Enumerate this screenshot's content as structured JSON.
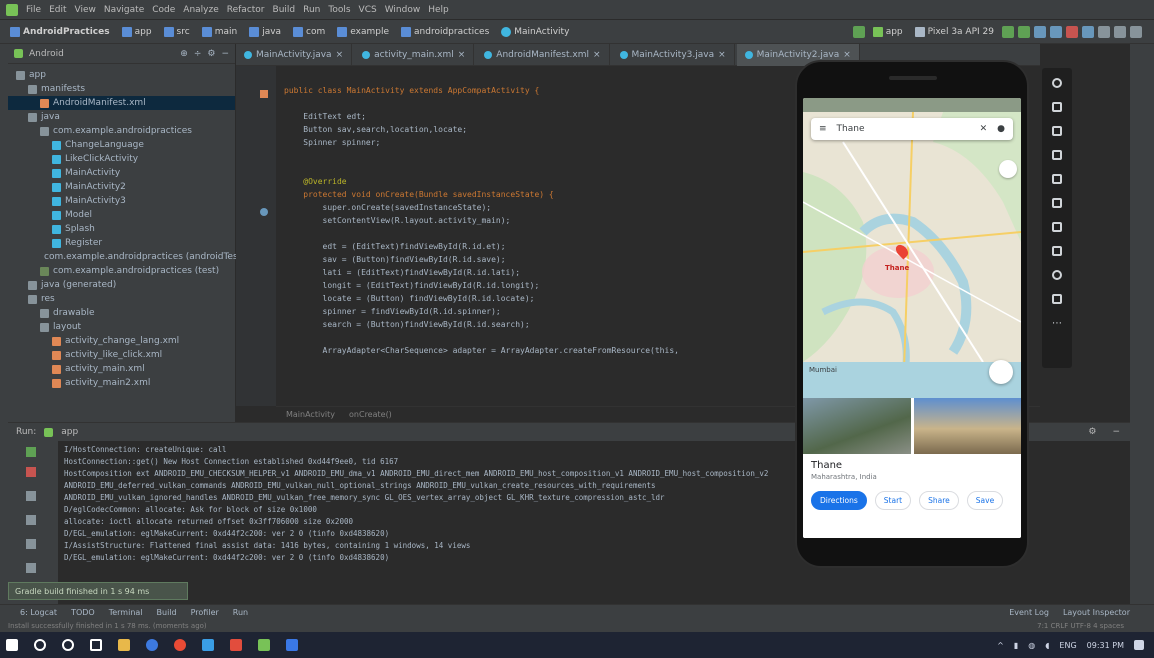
{
  "titlebar": {
    "menus": [
      "File",
      "Edit",
      "View",
      "Navigate",
      "Code",
      "Analyze",
      "Refactor",
      "Build",
      "Run",
      "Tools",
      "VCS",
      "Window",
      "Help"
    ]
  },
  "navbar": {
    "crumbs": [
      "AndroidPractices",
      "app",
      "src",
      "main",
      "java",
      "com",
      "example",
      "androidpractices",
      "MainActivity"
    ],
    "device": "app",
    "device_select": "Pixel 3a API 29"
  },
  "project": {
    "dropdown": "Android",
    "items": [
      {
        "label": "app",
        "level": 0,
        "color": "#87939a"
      },
      {
        "label": "manifests",
        "level": 1,
        "color": "#87939a"
      },
      {
        "label": "AndroidManifest.xml",
        "level": 2,
        "color": "#e08855",
        "selected": true
      },
      {
        "label": "java",
        "level": 1,
        "color": "#87939a"
      },
      {
        "label": "com.example.androidpractices",
        "level": 2,
        "color": "#87939a"
      },
      {
        "label": "ChangeLanguage",
        "level": 3,
        "color": "#40b6e0"
      },
      {
        "label": "LikeClickActivity",
        "level": 3,
        "color": "#40b6e0"
      },
      {
        "label": "MainActivity",
        "level": 3,
        "color": "#40b6e0"
      },
      {
        "label": "MainActivity2",
        "level": 3,
        "color": "#40b6e0"
      },
      {
        "label": "MainActivity3",
        "level": 3,
        "color": "#40b6e0"
      },
      {
        "label": "Model",
        "level": 3,
        "color": "#40b6e0"
      },
      {
        "label": "Splash",
        "level": 3,
        "color": "#40b6e0"
      },
      {
        "label": "Register",
        "level": 3,
        "color": "#40b6e0"
      },
      {
        "label": "com.example.androidpractices (androidTest)",
        "level": 2,
        "color": "#6a8759"
      },
      {
        "label": "com.example.androidpractices (test)",
        "level": 2,
        "color": "#6a8759"
      },
      {
        "label": "java (generated)",
        "level": 1,
        "color": "#87939a"
      },
      {
        "label": "res",
        "level": 1,
        "color": "#87939a"
      },
      {
        "label": "drawable",
        "level": 2,
        "color": "#87939a"
      },
      {
        "label": "layout",
        "level": 2,
        "color": "#87939a"
      },
      {
        "label": "activity_change_lang.xml",
        "level": 3,
        "color": "#e08855"
      },
      {
        "label": "activity_like_click.xml",
        "level": 3,
        "color": "#e08855"
      },
      {
        "label": "activity_main.xml",
        "level": 3,
        "color": "#e08855"
      },
      {
        "label": "activity_main2.xml",
        "level": 3,
        "color": "#e08855"
      }
    ]
  },
  "tabs": [
    {
      "label": "MainActivity.java",
      "active": false
    },
    {
      "label": "activity_main.xml",
      "active": false
    },
    {
      "label": "AndroidManifest.xml",
      "active": false
    },
    {
      "label": "MainActivity3.java",
      "active": false
    },
    {
      "label": "MainActivity2.java",
      "active": true
    }
  ],
  "editor": {
    "lines": [
      "public class MainActivity extends AppCompatActivity {",
      "",
      "    EditText edt;",
      "    Button sav,search,location,locate;",
      "    Spinner spinner;",
      "",
      "",
      "    @Override",
      "    protected void onCreate(Bundle savedInstanceState) {",
      "        super.onCreate(savedInstanceState);",
      "        setContentView(R.layout.activity_main);",
      "",
      "        edt = (EditText)findViewById(R.id.et);",
      "        sav = (Button)findViewById(R.id.save);",
      "        lati = (EditText)findViewById(R.id.lati);",
      "        longit = (EditText)findViewById(R.id.longit);",
      "        locate = (Button) findViewById(R.id.locate);",
      "        spinner = findViewById(R.id.spinner);",
      "        search = (Button)findViewById(R.id.search);",
      "",
      "        ArrayAdapter<CharSequence> adapter = ArrayAdapter.createFromResource(this,"
    ],
    "breadcrumb": [
      "MainActivity",
      "onCreate()"
    ]
  },
  "logcat": {
    "title": "Run:",
    "run_config": "app",
    "lines": [
      "I/HostConnection: createUnique: call",
      "    HostConnection::get() New Host Connection established 0xd44f9ee0, tid 6167",
      "    HostComposition ext ANDROID_EMU_CHECKSUM_HELPER_v1 ANDROID_EMU_dma_v1 ANDROID_EMU_direct_mem ANDROID_EMU_host_composition_v1 ANDROID_EMU_host_composition_v2",
      "    ANDROID_EMU_deferred_vulkan_commands ANDROID_EMU_vulkan_null_optional_strings ANDROID_EMU_vulkan_create_resources_with_requirements",
      "    ANDROID_EMU_vulkan_ignored_handles ANDROID_EMU_vulkan_free_memory_sync GL_OES_vertex_array_object GL_KHR_texture_compression_astc_ldr",
      "D/eglCodecCommon: allocate: Ask for block of size 0x1000",
      "    allocate: ioctl allocate returned offset 0x3ff706000 size 0x2000",
      "D/EGL_emulation: eglMakeCurrent: 0xd44f2c200: ver 2 0 (tinfo 0xd4838620)",
      "I/AssistStructure: Flattened final assist data: 1416 bytes, containing 1 windows, 14 views",
      "D/EGL_emulation: eglMakeCurrent: 0xd44f2c200: ver 2 0 (tinfo 0xd4838620)"
    ]
  },
  "gradle_balloon": "Gradle build finished in 1 s 94 ms",
  "bottom_tools": [
    "6: Logcat",
    "TODO",
    "Terminal",
    "Build",
    "Profiler",
    "Run"
  ],
  "bottom_right": [
    "Event Log",
    "Layout Inspector"
  ],
  "status": "Install successfully finished in 1 s 78 ms. (moments ago)",
  "status_right": "7:1  CRLF  UTF-8  4 spaces",
  "phone": {
    "search_text": "Thane",
    "place_name": "Thane",
    "place_sub": "Maharashtra, India",
    "map_label": "Thane",
    "map_label2": "Mumbai",
    "actions": [
      "Directions",
      "Start",
      "Share",
      "Save"
    ]
  },
  "taskbar": {
    "time": "09:31 PM",
    "lang": "ENG"
  }
}
